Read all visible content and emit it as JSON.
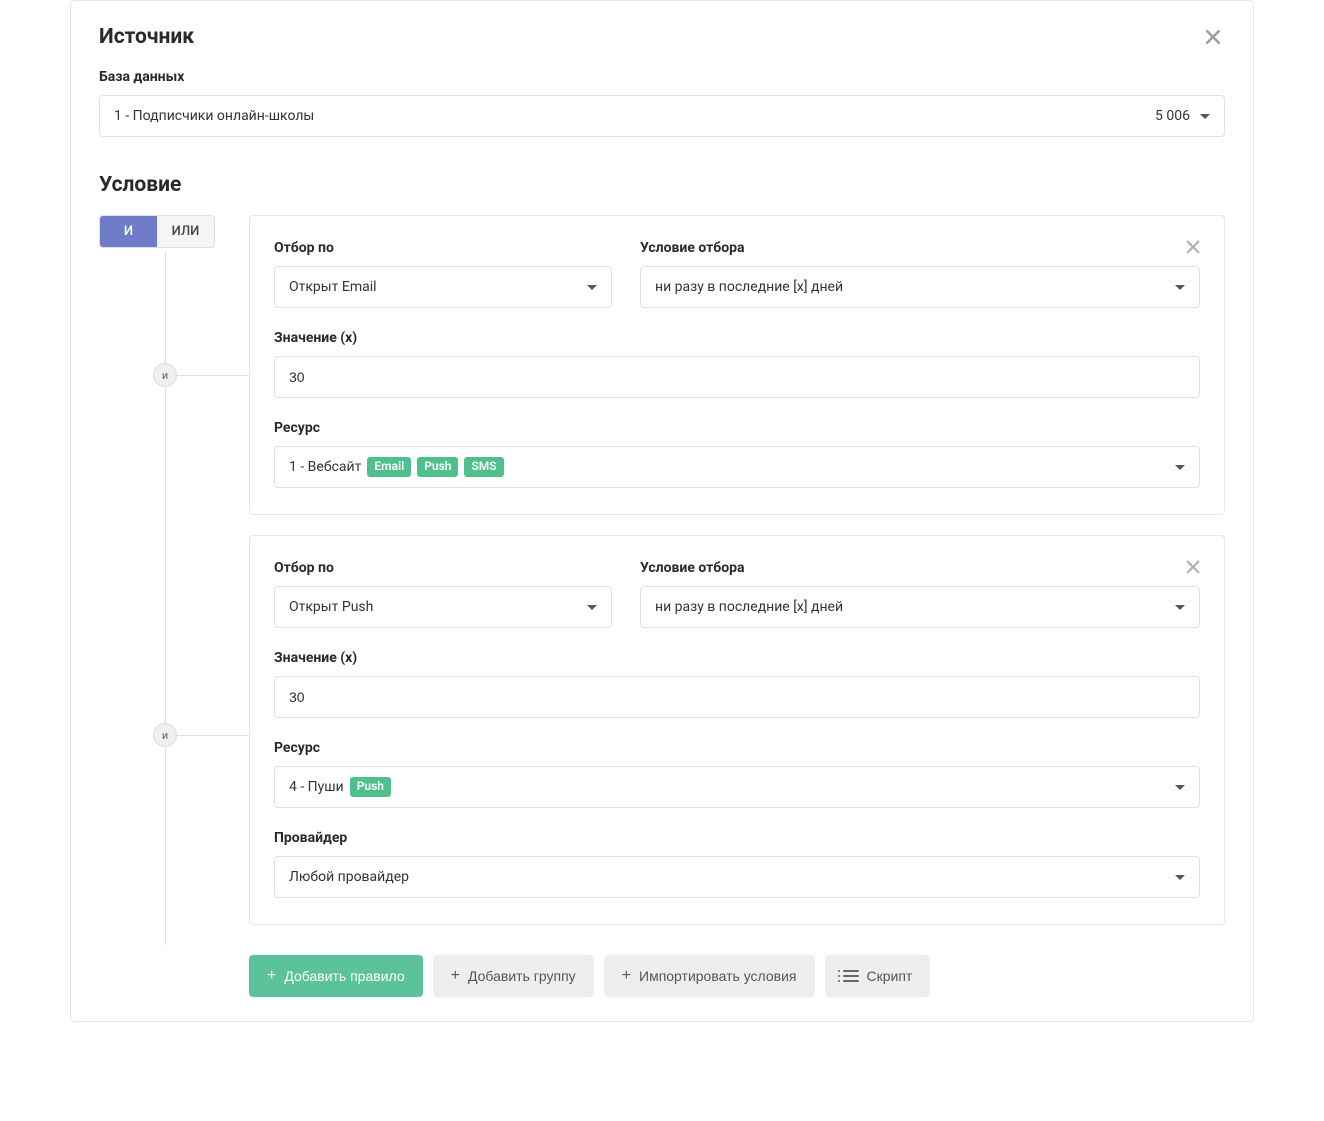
{
  "source": {
    "title": "Источник",
    "db_label": "База данных",
    "db_value": "1 - Подписчики онлайн-школы",
    "db_count": "5 006"
  },
  "condition": {
    "title": "Условие",
    "tab_and": "И",
    "tab_or": "ИЛИ",
    "connector_label": "и"
  },
  "labels": {
    "filter_by": "Отбор по",
    "filter_condition": "Условие отбора",
    "value_x": "Значение (x)",
    "resource": "Ресурс",
    "provider": "Провайдер"
  },
  "rule1": {
    "filter_by": "Открыт Email",
    "filter_condition": "ни разу в последние [x] дней",
    "value": "30",
    "resource_text": "1 - Вебсайт",
    "badges": [
      "Email",
      "Push",
      "SMS"
    ]
  },
  "rule2": {
    "filter_by": "Открыт Push",
    "filter_condition": "ни разу в последние [x] дней",
    "value": "30",
    "resource_text": "4 - Пуши",
    "badges": [
      "Push"
    ],
    "provider": "Любой провайдер"
  },
  "actions": {
    "add_rule": "Добавить правило",
    "add_group": "Добавить группу",
    "import_conditions": "Импортировать условия",
    "script": "Скрипт"
  }
}
